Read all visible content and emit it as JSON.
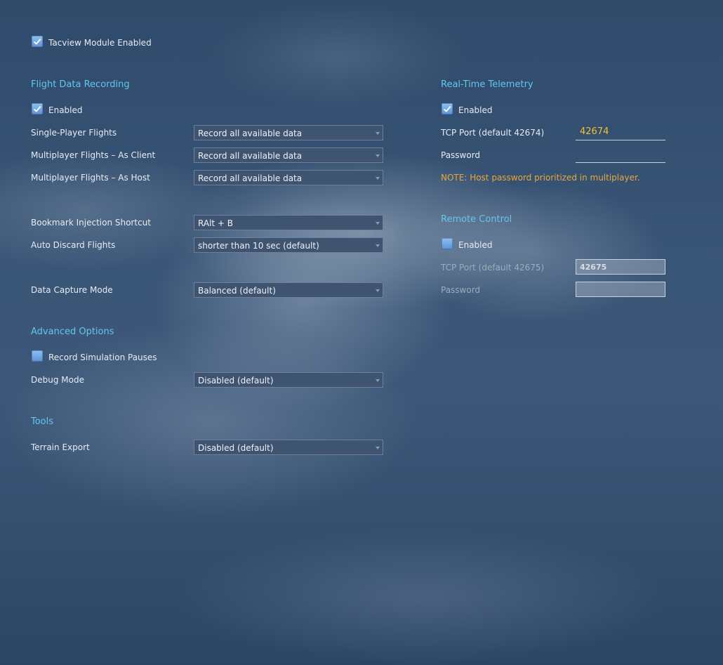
{
  "module_enabled": {
    "label": "Tacview Module Enabled",
    "checked": true
  },
  "flight_data_recording": {
    "title": "Flight Data Recording",
    "enabled": {
      "label": "Enabled",
      "checked": true
    },
    "single_player": {
      "label": "Single-Player Flights",
      "value": "Record all available data"
    },
    "mp_client": {
      "label": "Multiplayer Flights – As Client",
      "value": "Record all available data"
    },
    "mp_host": {
      "label": "Multiplayer Flights – As Host",
      "value": "Record all available data"
    },
    "bookmark_shortcut": {
      "label": "Bookmark Injection Shortcut",
      "value": "RAlt + B"
    },
    "auto_discard": {
      "label": "Auto Discard Flights",
      "value": "shorter than 10 sec (default)"
    },
    "capture_mode": {
      "label": "Data Capture Mode",
      "value": "Balanced (default)"
    }
  },
  "advanced_options": {
    "title": "Advanced Options",
    "record_pauses": {
      "label": "Record Simulation Pauses",
      "checked": false
    },
    "debug_mode": {
      "label": "Debug Mode",
      "value": "Disabled (default)"
    }
  },
  "tools": {
    "title": "Tools",
    "terrain_export": {
      "label": "Terrain Export",
      "value": "Disabled (default)"
    }
  },
  "telemetry": {
    "title": "Real-Time Telemetry",
    "enabled": {
      "label": "Enabled",
      "checked": true
    },
    "port": {
      "label": "TCP Port (default 42674)",
      "value": "42674"
    },
    "password": {
      "label": "Password",
      "value": ""
    },
    "note": "NOTE: Host password prioritized in multiplayer."
  },
  "remote_control": {
    "title": "Remote Control",
    "enabled": {
      "label": "Enabled",
      "checked": false
    },
    "port": {
      "label": "TCP Port (default 42675)",
      "value": "42675"
    },
    "password": {
      "label": "Password",
      "value": ""
    }
  },
  "colors": {
    "section_title": "#63c6ea",
    "note": "#e9a63a",
    "port_value": "#f0c02e",
    "checkbox": "#6aa3e2"
  }
}
